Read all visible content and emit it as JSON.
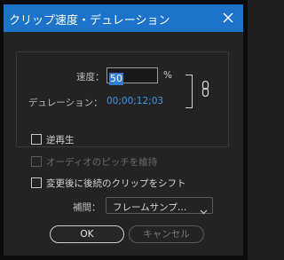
{
  "window": {
    "title": "クリップ速度・デュレーション",
    "close_icon": "close-icon"
  },
  "speed": {
    "label": "速度：",
    "value": "50",
    "unit": "%"
  },
  "duration": {
    "label": "デュレーション：",
    "value": "00;00;12;03"
  },
  "link_icon": "chain-link-icon",
  "options": {
    "reverse": {
      "label": "逆再生",
      "checked": false,
      "enabled": true
    },
    "maintain_pitch": {
      "label": "オーディオのピッチを維持",
      "checked": false,
      "enabled": false
    },
    "ripple_edit": {
      "label": "変更後に後続のクリップをシフト",
      "checked": false,
      "enabled": true
    }
  },
  "interpolation": {
    "label": "補間：",
    "selected": "フレームサンプ…"
  },
  "buttons": {
    "ok": "OK",
    "cancel": "キャンセル"
  },
  "colors": {
    "titlebar": "#1c73c9",
    "accent_blue": "#3f97ea",
    "selection": "#2f7bd6",
    "background": "#232323"
  }
}
